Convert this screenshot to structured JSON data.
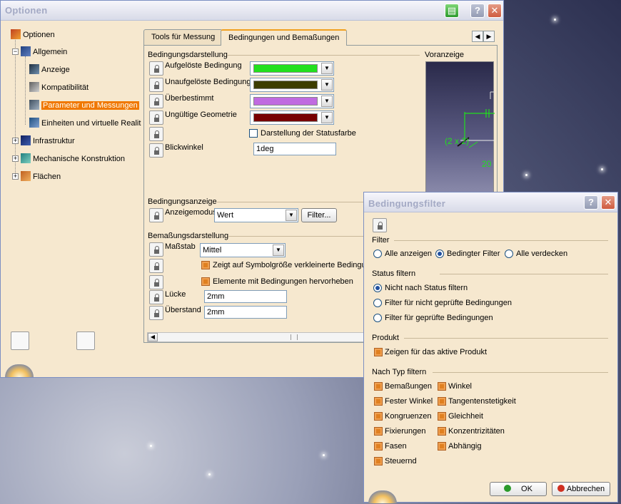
{
  "options_window": {
    "title": "Optionen",
    "tree": [
      {
        "label": "Optionen"
      },
      {
        "label": "Allgemein"
      },
      {
        "label": "Anzeige"
      },
      {
        "label": "Kompatibilität"
      },
      {
        "label": "Parameter und Messungen",
        "selected": true
      },
      {
        "label": "Einheiten und virtuelle Realit"
      },
      {
        "label": "Infrastruktur"
      },
      {
        "label": "Mechanische Konstruktion"
      },
      {
        "label": "Flächen"
      }
    ],
    "tabs": [
      {
        "label": "Tools für Messung"
      },
      {
        "label": "Bedingungen und Bemaßungen",
        "active": true
      }
    ],
    "constraint_display": {
      "title": "Bedingungsdarstellung",
      "rows": [
        {
          "label": "Aufgelöste Bedingung",
          "color": "#22e01e"
        },
        {
          "label": "Unaufgelöste Bedingung",
          "color": "#3d3d00"
        },
        {
          "label": "Überbestimmt",
          "color": "#c06ae0"
        },
        {
          "label": "Ungültige Geometrie",
          "color": "#780000"
        }
      ],
      "status_color_label": "Darstellung der Statusfarbe",
      "view_angle_label": "Blickwinkel",
      "view_angle_value": "1deg"
    },
    "preview_title": "Voranzeige",
    "preview_labels": [
      "(2 x 2)",
      "20"
    ],
    "constraint_view": {
      "title": "Bedingungsanzeige",
      "mode_label": "Anzeigemodus",
      "mode_value": "Wert",
      "filter_button": "Filter..."
    },
    "dimension_display": {
      "title": "Bemaßungsdarstellung",
      "scale_label": "Maßstab",
      "scale_value": "Mittel",
      "check1": "Zeigt auf Symbolgröße verkleinerte Bedingur",
      "check2": "Elemente mit Bedingungen hervorheben",
      "gap_label": "Lücke",
      "gap_value": "2mm",
      "overhang_label": "Überstand",
      "overhang_value": "2mm"
    }
  },
  "filter_dialog": {
    "title": "Bedingungsfilter",
    "filter_group": "Filter",
    "filter_options": [
      {
        "label": "Alle anzeigen",
        "selected": false
      },
      {
        "label": "Bedingter Filter",
        "selected": true
      },
      {
        "label": "Alle verdecken",
        "selected": false
      }
    ],
    "status_group": "Status filtern",
    "status_options": [
      {
        "label": "Nicht nach Status filtern",
        "selected": true
      },
      {
        "label": "Filter für nicht geprüfte Bedingungen",
        "selected": false
      },
      {
        "label": "Filter für geprüfte Bedingungen",
        "selected": false
      }
    ],
    "product_group": "Produkt",
    "product_check": "Zeigen für das aktive Produkt",
    "type_group": "Nach Typ filtern",
    "type_col1": [
      "Bemaßungen",
      "Fester Winkel",
      "Kongruenzen",
      "Fixierungen",
      "Fasen",
      "Steuernd"
    ],
    "type_col2": [
      "Winkel",
      "Tangentenstetigkeit",
      "Gleichheit",
      "Konzentrizitäten",
      "Abhängig"
    ],
    "ok_label": "OK",
    "cancel_label": "Abbrechen"
  }
}
